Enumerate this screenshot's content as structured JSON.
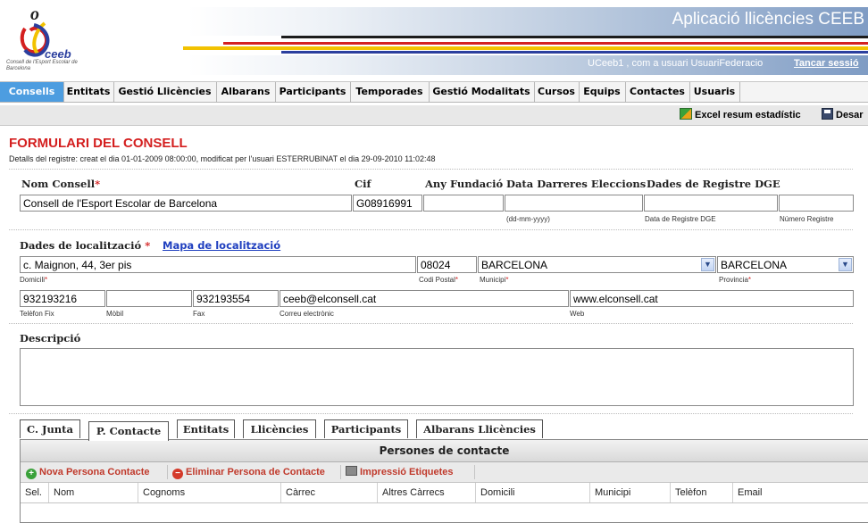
{
  "header": {
    "app_title": "Aplicació llicències CEEB",
    "user_info": "UCeeb1 , com a usuari UsuariFederacio",
    "logout_label": "Tancar sessió",
    "logo_text": "ceeb",
    "logo_subtext": "Consell de l'Esport Escolar de Barcelona"
  },
  "menu": {
    "items": [
      {
        "label": "Consells",
        "active": true
      },
      {
        "label": "Entitats"
      },
      {
        "label": "Gestió Llicències"
      },
      {
        "label": "Albarans"
      },
      {
        "label": "Participants"
      },
      {
        "label": "Temporades"
      },
      {
        "label": "Gestió Modalitats"
      },
      {
        "label": "Cursos"
      },
      {
        "label": "Equips"
      },
      {
        "label": "Contactes"
      },
      {
        "label": "Usuaris"
      }
    ]
  },
  "toolbar": {
    "excel_label": "Excel resum estadístic",
    "save_label": "Desar"
  },
  "form": {
    "title": "FORMULARI DEL CONSELL",
    "subtitle": "Detalls del registre: creat el dia 01-01-2009 08:00:00, modificat per l'usuari ESTERRUBINAT el dia 29-09-2010 11:02:48",
    "labels": {
      "nom_consell": "Nom Consell",
      "cif": "Cif",
      "any_fundacio": "Any Fundació",
      "data_eleccions": "Data Darreres Eleccions",
      "dades_dge": "Dades de Registre DGE",
      "localitzacio": "Dades de localització",
      "mapa": "Mapa de localització",
      "descripcio": "Descripció"
    },
    "required_mark": "*",
    "values": {
      "nom_consell": "Consell de l'Esport Escolar de Barcelona",
      "cif": "G08916991",
      "any_fundacio": "",
      "data_eleccions": "",
      "data_registre_dge": "",
      "numero_registre": "",
      "domicili": "c. Maignon, 44, 3er pis",
      "codi_postal": "08024",
      "municipi": "BARCELONA",
      "provincia": "BARCELONA",
      "telefon_fix": "932193216",
      "mobil": "",
      "fax": "932193554",
      "correu": "ceeb@elconsell.cat",
      "web": "www.elconsell.cat",
      "descripcio": ""
    },
    "hints": {
      "date_format": "(dd-mm-yyyy)",
      "data_registre_dge": "Data de Registre DGE",
      "numero_registre": "Número Registre",
      "domicili": "Domicili",
      "codi_postal": "Codi Postal",
      "municipi": "Municipi",
      "provincia": "Provincia",
      "telefon_fix": "Telèfon Fix",
      "mobil": "Mòbil",
      "fax": "Fax",
      "correu": "Correu electrònic",
      "web": "Web"
    }
  },
  "tabs": [
    {
      "label": "C. Junta"
    },
    {
      "label": "P. Contacte",
      "active": true
    },
    {
      "label": "Entitats"
    },
    {
      "label": "Llicències"
    },
    {
      "label": "Participants"
    },
    {
      "label": "Albarans Llicències"
    }
  ],
  "panel": {
    "title": "Persones de contacte",
    "tools": {
      "new_label": "Nova Persona Contacte",
      "delete_label": "Eliminar Persona de Contacte",
      "print_label": "Impressió Etiquetes"
    },
    "columns": [
      "Sel.",
      "Nom",
      "Cognoms",
      "Càrrec",
      "Altres Càrrecs",
      "Domicili",
      "Municipi",
      "Telèfon",
      "Email"
    ]
  },
  "colors": {
    "menu_active": "#4d9de0",
    "title_red": "#d41f1f",
    "link_blue": "#1f3fbf"
  }
}
